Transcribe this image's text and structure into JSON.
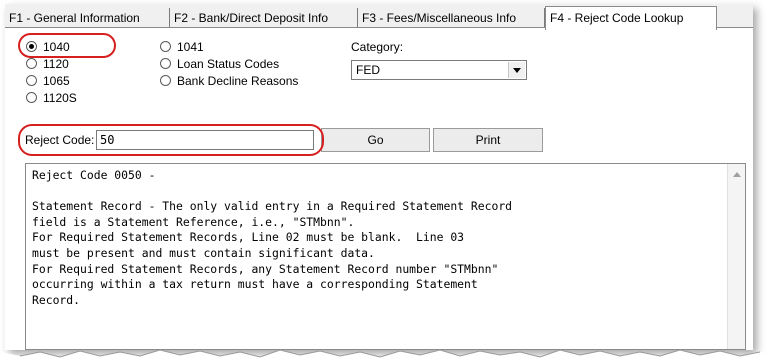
{
  "tabs": [
    {
      "label": "F1 - General Information"
    },
    {
      "label": "F2 - Bank/Direct Deposit Info"
    },
    {
      "label": "F3 - Fees/Miscellaneous Info"
    },
    {
      "label": "F4 - Reject Code Lookup"
    }
  ],
  "return_types": {
    "col1": [
      {
        "label": "1040",
        "selected": true
      },
      {
        "label": "1120",
        "selected": false
      },
      {
        "label": "1065",
        "selected": false
      },
      {
        "label": "1120S",
        "selected": false
      }
    ],
    "col2": [
      {
        "label": "1041",
        "selected": false
      },
      {
        "label": "Loan Status Codes",
        "selected": false
      },
      {
        "label": "Bank Decline Reasons",
        "selected": false
      }
    ]
  },
  "category": {
    "label": "Category:",
    "value": "FED"
  },
  "reject_code": {
    "label": "Reject Code:",
    "value": "50"
  },
  "buttons": {
    "go": "Go",
    "print": "Print"
  },
  "result_text": "Reject Code 0050 -\n\nStatement Record - The only valid entry in a Required Statement Record\nfield is a Statement Reference, i.e., \"STMbnn\".\nFor Required Statement Records, Line 02 must be blank.  Line 03\nmust be present and must contain significant data.\nFor Required Statement Records, any Statement Record number \"STMbnn\"\noccurring within a tax return must have a corresponding Statement\nRecord.",
  "colors": {
    "highlight": "#d62020",
    "window_bg": "#f0f0f0"
  }
}
